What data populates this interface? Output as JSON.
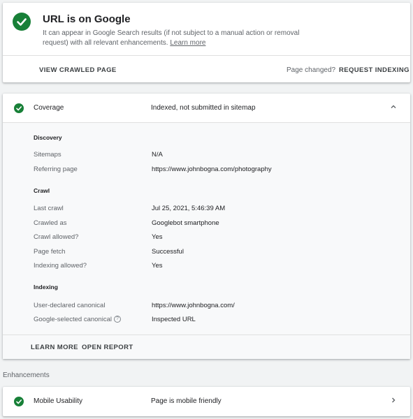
{
  "status": {
    "title": "URL is on Google",
    "description": "It can appear in Google Search results (if not subject to a manual action or removal request) with all relevant enhancements.",
    "learn_more": "Learn more",
    "view_crawled": "VIEW CRAWLED PAGE",
    "page_changed": "Page changed?",
    "request_indexing": "REQUEST INDEXING"
  },
  "coverage": {
    "label": "Coverage",
    "value": "Indexed, not submitted in sitemap",
    "sections": {
      "discovery": "Discovery",
      "crawl": "Crawl",
      "indexing": "Indexing"
    },
    "rows": {
      "sitemaps": {
        "k": "Sitemaps",
        "v": "N/A"
      },
      "referring": {
        "k": "Referring page",
        "v": "https://www.johnbogna.com/photography"
      },
      "last_crawl": {
        "k": "Last crawl",
        "v": "Jul 25, 2021, 5:46:39 AM"
      },
      "crawled_as": {
        "k": "Crawled as",
        "v": "Googlebot smartphone"
      },
      "crawl_allowed": {
        "k": "Crawl allowed?",
        "v": "Yes"
      },
      "page_fetch": {
        "k": "Page fetch",
        "v": "Successful"
      },
      "indexing_allowed": {
        "k": "Indexing allowed?",
        "v": "Yes"
      },
      "user_canonical": {
        "k": "User-declared canonical",
        "v": "https://www.johnbogna.com/"
      },
      "google_canonical": {
        "k": "Google-selected canonical",
        "v": "Inspected URL"
      }
    },
    "learn_more": "LEARN MORE",
    "open_report": "OPEN REPORT"
  },
  "enhancements": {
    "heading": "Enhancements",
    "mobile_label": "Mobile Usability",
    "mobile_value": "Page is mobile friendly"
  },
  "colors": {
    "success": "#188038"
  },
  "icons": {
    "check": "check-circle-icon",
    "collapse": "chevron-up-icon",
    "expand": "chevron-right-icon",
    "help": "help-circle-icon"
  }
}
